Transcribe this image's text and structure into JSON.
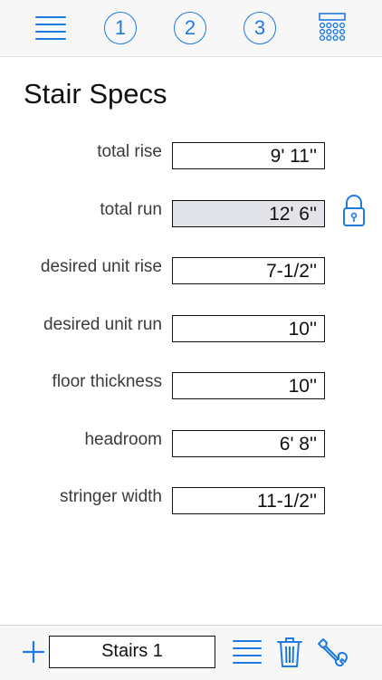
{
  "accent_color": "#1f7ae0",
  "toolbar": {
    "menu_icon": "menu-lines-icon",
    "steps": [
      "1",
      "2",
      "3"
    ],
    "keypad_icon": "keypad-icon"
  },
  "page": {
    "title": "Stair Specs"
  },
  "fields": [
    {
      "label": "total rise",
      "value": "9' 11''",
      "locked": false
    },
    {
      "label": "total run",
      "value": "12' 6''",
      "locked": true
    },
    {
      "label": "desired unit rise",
      "value": "7-1/2''",
      "locked": false
    },
    {
      "label": "desired unit run",
      "value": "10''",
      "locked": false
    },
    {
      "label": "floor thickness",
      "value": "10''",
      "locked": false
    },
    {
      "label": "headroom",
      "value": "6' 8''",
      "locked": false
    },
    {
      "label": "stringer width",
      "value": "11-1/2''",
      "locked": false
    }
  ],
  "lock_icon": "lock-icon",
  "bottom_bar": {
    "add_icon": "plus-icon",
    "project_name": "Stairs 1",
    "list_icon": "list-icon",
    "delete_icon": "trash-icon",
    "settings_icon": "wrench-icon"
  }
}
